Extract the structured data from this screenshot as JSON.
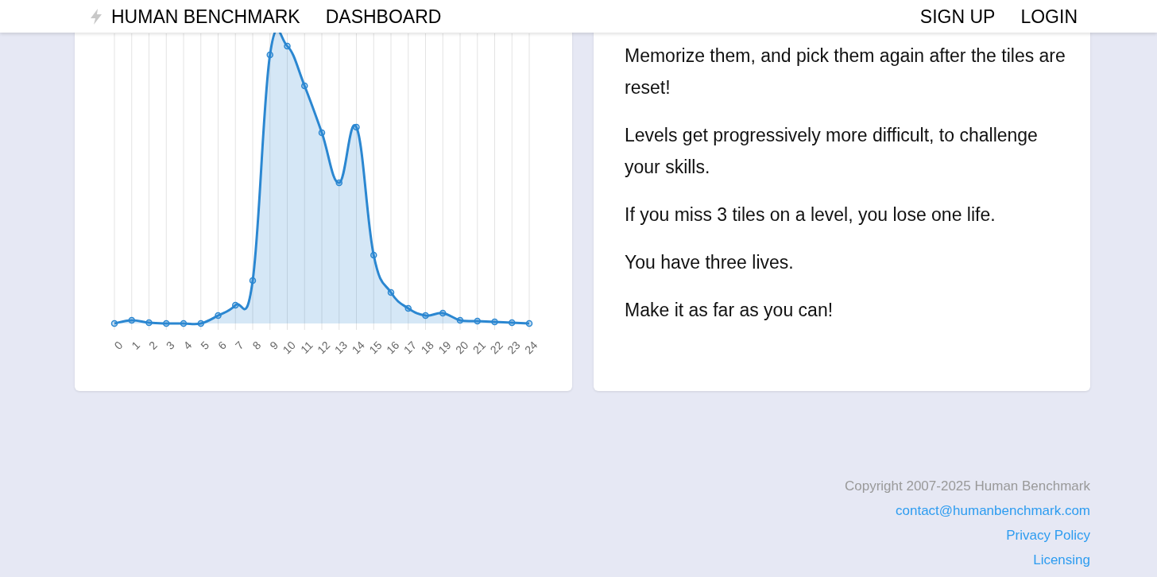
{
  "nav": {
    "brand": "HUMAN BENCHMARK",
    "links": [
      "DASHBOARD"
    ],
    "right_links": [
      "SIGN UP",
      "LOGIN"
    ]
  },
  "chart": {
    "x_labels": [
      "0",
      "1",
      "2",
      "3",
      "4",
      "5",
      "6",
      "7",
      "8",
      "9",
      "10",
      "11",
      "12",
      "13",
      "14",
      "15",
      "16",
      "17",
      "18",
      "19",
      "20",
      "21",
      "22",
      "23",
      "24"
    ]
  },
  "instructions": [
    "Memorize them, and pick them again after the tiles are reset!",
    "Levels get progressively more difficult, to challenge your skills.",
    "If you miss 3 tiles on a level, you lose one life.",
    "You have three lives.",
    "Make it as far as you can!"
  ],
  "footer": {
    "copyright": "Copyright 2007-2025 Human Benchmark",
    "links": [
      "contact@humanbenchmark.com",
      "Privacy Policy",
      "Licensing"
    ]
  }
}
